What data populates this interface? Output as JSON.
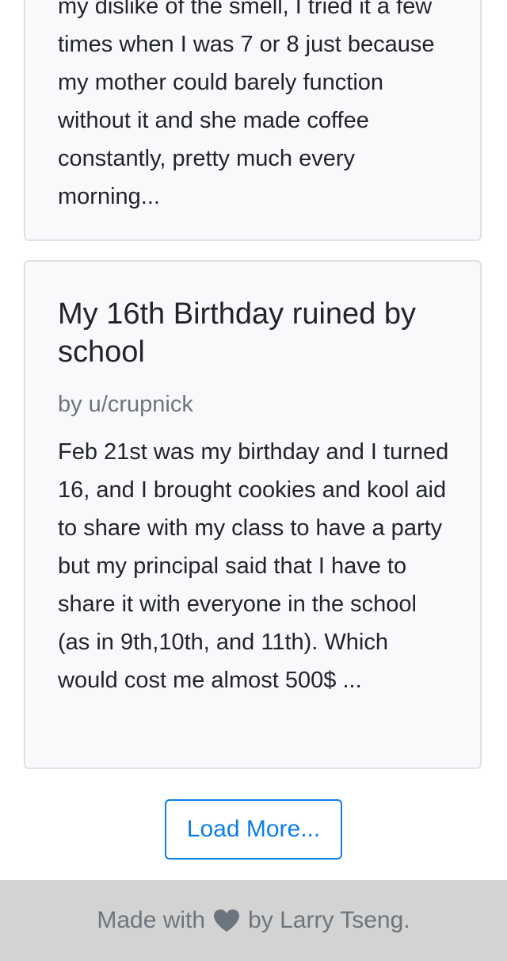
{
  "posts": [
    {
      "excerpt": "my dislike of the smell, I tried it a few times when I was 7 or 8 just because my mother could barely function without it and she made coffee constantly, pretty much every morning..."
    },
    {
      "title": "My 16th Birthday ruined by school",
      "author": "by u/crupnick",
      "excerpt": "Feb 21st was my birthday and I turned 16, and I brought cookies and kool aid to share with my class to have a party but my principal said that I have to share it with everyone in the school (as in 9th,10th, and 11th). Which would cost me almost 500$ ..."
    }
  ],
  "load_more": {
    "label": "Load More..."
  },
  "footer": {
    "prefix": "Made with",
    "icon": "heart-icon",
    "suffix": "by Larry Tseng."
  },
  "colors": {
    "accent": "#0d7ee8",
    "muted": "#6c757d",
    "card_bg": "#f9f9fb",
    "footer_bg": "#d3d3d3"
  }
}
